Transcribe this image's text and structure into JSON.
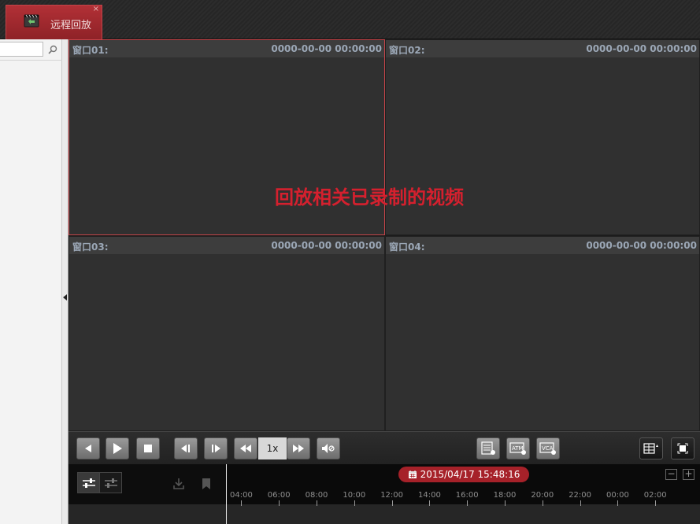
{
  "tab": {
    "label": "远程回放",
    "close": "×"
  },
  "left_panel": {
    "search_placeholder": ""
  },
  "windows": [
    {
      "title": "窗口01:",
      "time": "0000-00-00 00:00:00"
    },
    {
      "title": "窗口02:",
      "time": "0000-00-00 00:00:00"
    },
    {
      "title": "窗口03:",
      "time": "0000-00-00 00:00:00"
    },
    {
      "title": "窗口04:",
      "time": "0000-00-00 00:00:00"
    }
  ],
  "overlay_text": "回放相关已录制的视频",
  "controls": {
    "speed": "1x",
    "icons": [
      "reverse-play-icon",
      "play-icon",
      "stop-icon",
      "frame-back-icon",
      "frame-forward-icon",
      "slow-icon",
      "fast-icon",
      "mute-icon",
      "event-search-icon",
      "atm-search-icon",
      "vca-search-icon",
      "layout-icon",
      "fullscreen-icon"
    ],
    "atm_label": "ATM",
    "vca_label": "VCA"
  },
  "timeline": {
    "datetime": "2015/04/17 15:48:16",
    "zoom_out": "−",
    "zoom_in": "+",
    "ticks": [
      "04:00",
      "06:00",
      "08:00",
      "10:00",
      "12:00",
      "14:00",
      "16:00",
      "18:00",
      "20:00",
      "22:00",
      "00:00",
      "02:00"
    ]
  },
  "colors": {
    "accent_red": "#a62129",
    "overlay_red": "#d5202e",
    "window_bg": "#303030",
    "header_text": "#9ba7b6"
  }
}
